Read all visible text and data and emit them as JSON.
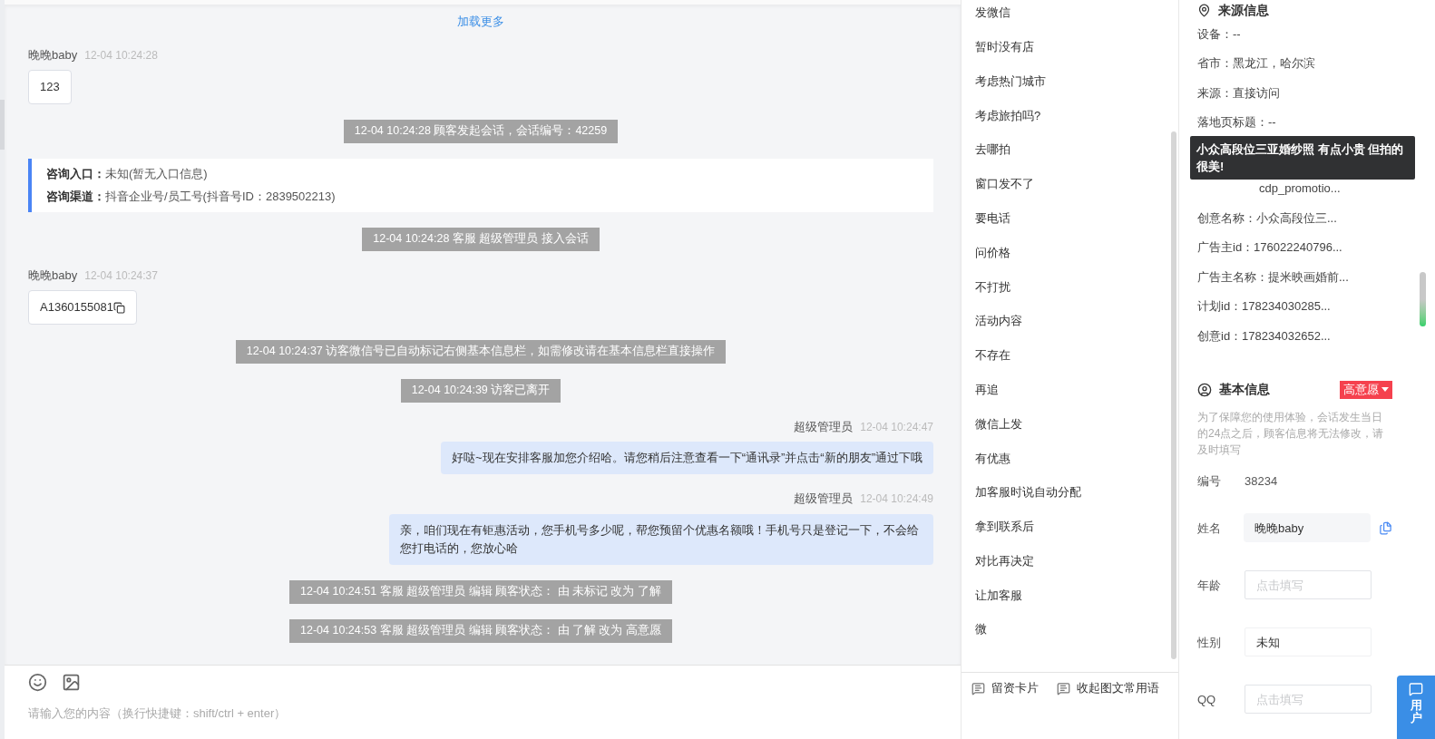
{
  "chat": {
    "load_more": "加载更多",
    "messages": [
      {
        "kind": "visitor",
        "name": "晚晚baby",
        "time": "12-04 10:24:28",
        "text": "123",
        "copyable": false
      },
      {
        "kind": "system",
        "text": "12-04 10:24:28 顾客发起会话，会话编号：42259"
      },
      {
        "kind": "info",
        "rows": [
          {
            "label": "咨询入口：",
            "value": "未知(暂无入口信息)"
          },
          {
            "label": "咨询渠道：",
            "value": "抖音企业号/员工号(抖音号ID：2839502213)"
          }
        ]
      },
      {
        "kind": "system",
        "text": "12-04 10:24:28 客服 超级管理员 接入会话"
      },
      {
        "kind": "visitor",
        "name": "晚晚baby",
        "time": "12-04 10:24:37",
        "text": "A1360155081",
        "copyable": true
      },
      {
        "kind": "system",
        "text": "12-04 10:24:37 访客微信号已自动标记右侧基本信息栏，如需修改请在基本信息栏直接操作"
      },
      {
        "kind": "system",
        "text": "12-04 10:24:39 访客已离开"
      },
      {
        "kind": "agent",
        "name": "超级管理员",
        "time": "12-04 10:24:47",
        "text": "好哒~现在安排客服加您介绍哈。请您稍后注意查看一下“通讯录”并点击“新的朋友”通过下哦"
      },
      {
        "kind": "agent",
        "name": "超级管理员",
        "time": "12-04 10:24:49",
        "text": "亲，咱们现在有钜惠活动，您手机号多少呢，帮您预留个优惠名额哦！手机号只是登记一下，不会给您打电话的，您放心哈"
      },
      {
        "kind": "system",
        "text": "12-04 10:24:51 客服 超级管理员 编辑 顾客状态： 由 未标记 改为 了解"
      },
      {
        "kind": "system",
        "text": "12-04 10:24:53 客服 超级管理员 编辑 顾客状态： 由 了解 改为 高意愿"
      }
    ],
    "input": {
      "placeholder": "请输入您的内容（换行快捷键：shift/ctrl + enter）"
    }
  },
  "phrases": [
    "发微信",
    "暂时没有店",
    "考虑热门城市",
    "考虑旅拍吗?",
    "去哪拍",
    "窗口发不了",
    "要电话",
    "问价格",
    "不打扰",
    "活动内容",
    "不存在",
    "再追",
    "微信上发",
    "有优惠",
    "加客服时说自动分配",
    "拿到联系后",
    "对比再决定",
    "让加客服",
    "微"
  ],
  "phrase_toolbar": [
    "留资卡片",
    "收起图文常用语"
  ],
  "source": {
    "title": "来源信息",
    "rows": [
      {
        "text": "设备：--"
      },
      {
        "text": "省市：黑龙江，哈尔滨"
      },
      {
        "text": "来源：直接访问"
      },
      {
        "text": "落地页标题：--"
      },
      {
        "text": "cdp_promotio...",
        "kind": "partial"
      },
      {
        "text": "创意名称：小众高段位三..."
      },
      {
        "text": "广告主id：176022240796..."
      },
      {
        "text": "广告主名称：提米映画婚前..."
      },
      {
        "text": "计划id：178234030285..."
      },
      {
        "text": "创意id：178234032652..."
      }
    ]
  },
  "tooltip": "小众高段位三亚婚纱照 有点小贵 但拍的很美!",
  "basic": {
    "title": "基本信息",
    "status": "高意愿",
    "note": "为了保障您的使用体验，会话发生当日的24点之后，顾客信息将无法修改，请及时填写",
    "fields": [
      {
        "kind": "text",
        "label": "编号",
        "value": "38234"
      },
      {
        "kind": "filled",
        "label": "姓名",
        "value": "晚晚baby"
      },
      {
        "kind": "input",
        "label": "年龄",
        "placeholder": "点击填写"
      },
      {
        "kind": "select",
        "label": "性别",
        "value": "未知"
      },
      {
        "kind": "input",
        "label": "QQ",
        "placeholder": "点击填写"
      }
    ]
  },
  "float_button": "用户"
}
